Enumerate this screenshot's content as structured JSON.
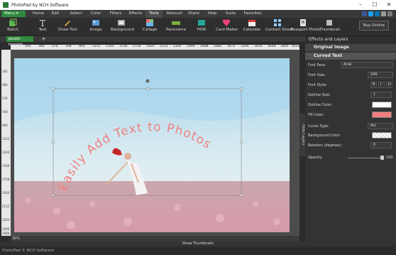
{
  "window": {
    "title": "PhotoPad by NCH Software"
  },
  "menu": {
    "button": "Menu ▾"
  },
  "tabs": [
    "Home",
    "Edit",
    "Select",
    "Color",
    "Filters",
    "Effects",
    "Tools",
    "Retouch",
    "Share",
    "Help",
    "Suite",
    "Favorites"
  ],
  "active_tab": "Tools",
  "toolbar": {
    "tools": [
      "Batch",
      "Text",
      "Draw Tool",
      "Image",
      "Background",
      "Collage",
      "Panorama",
      "HDR",
      "Card Maker",
      "Calendar",
      "Contact Sheet",
      "Passport Photo",
      "Thumbnail"
    ],
    "buy_online": "Buy Online"
  },
  "document": {
    "tab": "pexels-kowalsh...",
    "add": "+",
    "zoom": "30%"
  },
  "ruler": {
    "top": [
      "192",
      "384",
      "576",
      "768",
      "960",
      "1152",
      "1344",
      "1536",
      "1728",
      "1920",
      "2112",
      "2304",
      "2496",
      "2688",
      "2880",
      "3072",
      "3264",
      "3456",
      "3648",
      "3840",
      "4032"
    ],
    "left": [
      "192",
      "384",
      "576",
      "768",
      "960",
      "1152",
      "1344",
      "1536",
      "1728",
      "1920",
      "2112",
      "2304",
      "2496",
      "2688"
    ]
  },
  "canvas": {
    "curved_text": "Easily Add Text to Photos"
  },
  "side_tab": "Hide Layers",
  "panel": {
    "title": "Effects and Layers",
    "layers": [
      "Original Image",
      "Curved Text"
    ],
    "properties": {
      "font_face": {
        "label": "Font Face:",
        "value": "Arial"
      },
      "font_size": {
        "label": "Font Size:",
        "value": "240"
      },
      "font_style": {
        "label": "Font Style:",
        "buttons": [
          "B",
          "I",
          "U"
        ]
      },
      "outline_size": {
        "label": "Outline Size:",
        "value": "1"
      },
      "outline_color": {
        "label": "Outline Color:",
        "color": "#ffffff"
      },
      "fill_color": {
        "label": "Fill Color:",
        "color": "#f08080"
      },
      "curve_type": {
        "label": "Curve Type:",
        "value": "Arc"
      },
      "background_color": {
        "label": "Background Color:"
      },
      "rotation": {
        "label": "Rotation (degrees):",
        "value": "0"
      },
      "opacity": {
        "label": "Opacity:",
        "value": "100"
      }
    }
  },
  "bottom": {
    "show_thumbnails": "Show Thumbnails"
  },
  "footer": {
    "copyright": "PhotoPad © NCH Software"
  }
}
